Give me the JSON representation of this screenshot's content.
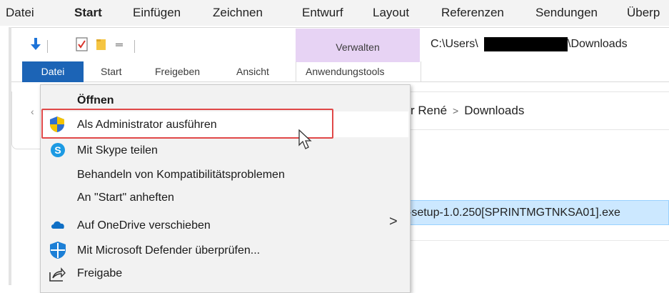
{
  "word_ribbon": {
    "tabs": [
      "Datei",
      "Start",
      "Einfügen",
      "Zeichnen",
      "Entwurf",
      "Layout",
      "Referenzen",
      "Sendungen",
      "Überp"
    ],
    "active": "Start"
  },
  "explorer": {
    "quick_access_icons": [
      "down-arrow-icon",
      "checklist-icon",
      "folder-icon",
      "customize-dropdown-icon"
    ],
    "manage_label": "Verwalten",
    "path_prefix": "C:\\Users\\",
    "path_suffix": "\\Downloads",
    "ribbon_tabs": {
      "file": "Datei",
      "start": "Start",
      "share": "Freigeben",
      "view": "Ansicht",
      "tools": "Anwendungstools"
    },
    "breadcrumb": {
      "user": "r René",
      "folder": "Downloads"
    },
    "selected_file": "-setup-1.0.250[SPRINTMGTNKSA01].exe"
  },
  "context_menu": {
    "items": [
      {
        "label": "Öffnen",
        "icon": "",
        "bold": true
      },
      {
        "label": "Als Administrator ausführen",
        "icon": "uac-shield-icon",
        "highlighted": true
      },
      {
        "label": "Mit Skype teilen",
        "icon": "skype-icon"
      },
      {
        "label": "Behandeln von Kompatibilitätsproblemen",
        "icon": ""
      },
      {
        "label": "An \"Start\" anheften",
        "icon": ""
      },
      {
        "label": "Auf OneDrive verschieben",
        "icon": "onedrive-icon",
        "submenu": true
      },
      {
        "label": "Mit Microsoft Defender überprüfen...",
        "icon": "defender-icon"
      },
      {
        "label": "Freigabe",
        "icon": "share-icon"
      }
    ]
  },
  "colors": {
    "file_tab": "#1c64b6",
    "manage_header": "#e7d3f4",
    "selection": "#cce8ff",
    "highlight_border": "#e04848"
  }
}
